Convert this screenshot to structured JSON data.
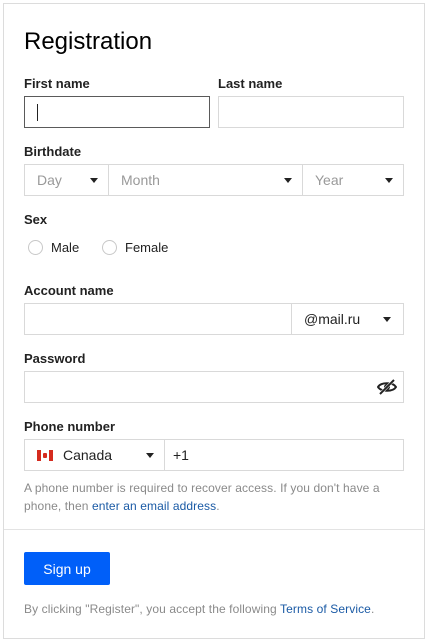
{
  "form": {
    "title": "Registration",
    "first_name_label": "First name",
    "last_name_label": "Last name",
    "birthdate_label": "Birthdate",
    "day_placeholder": "Day",
    "month_placeholder": "Month",
    "year_placeholder": "Year",
    "sex_label": "Sex",
    "sex_options": [
      "Male",
      "Female"
    ],
    "account_name_label": "Account name",
    "domain": "@mail.ru",
    "password_label": "Password",
    "phone_label": "Phone number",
    "country": "Canada",
    "phone_prefix": "+1",
    "hint_text": "A phone number is required to recover access. If you don't have a phone, then ",
    "hint_link": "enter an email address",
    "hint_end": ".",
    "submit_label": "Sign up",
    "terms_text": "By clicking \"Register\", you accept the following ",
    "terms_link": "Terms of Service",
    "terms_end": "."
  },
  "colors": {
    "accent": "#005ff9",
    "link": "#1a5aa5"
  }
}
